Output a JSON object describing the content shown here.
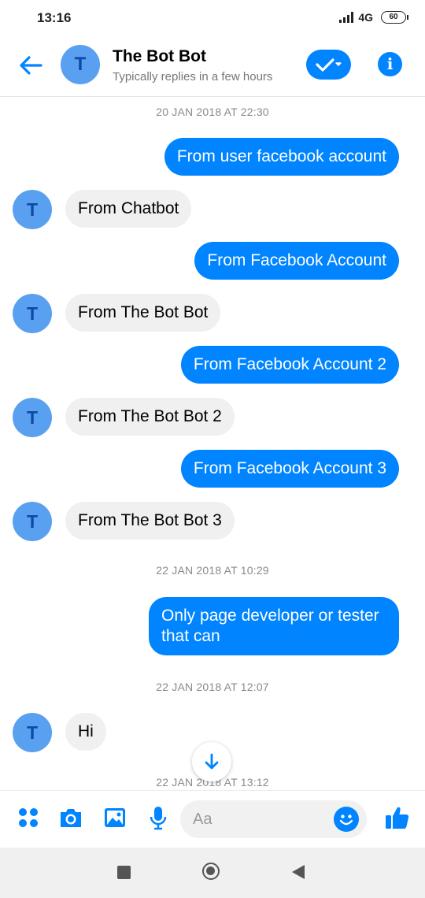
{
  "status_bar": {
    "time": "13:16",
    "network": "4G",
    "battery": "60"
  },
  "header": {
    "title": "The Bot Bot",
    "subtitle": "Typically replies in a few hours",
    "avatar_letter": "T",
    "accent_color": "#0084ff"
  },
  "messages": {
    "timestamp_1": "20 JAN 2018 AT 22:30",
    "out_1": "From user facebook account",
    "in_1": "From Chatbot",
    "out_2": "From Facebook Account",
    "in_2": "From The Bot Bot",
    "out_3": "From Facebook Account 2",
    "in_3": "From The Bot Bot 2",
    "out_4": "From Facebook Account 3",
    "in_4": "From The Bot Bot 3",
    "timestamp_2": "22 JAN 2018 AT 10:29",
    "out_5": "Only page developer or tester that can",
    "timestamp_3": "22 JAN 2018 AT 12:07",
    "in_5": "Hi",
    "timestamp_4": "22 JAN 2018 AT 13:12"
  },
  "composer": {
    "placeholder": "Aa"
  },
  "icons": [
    "back-arrow-icon",
    "check-icon",
    "info-icon",
    "apps-icon",
    "camera-icon",
    "gallery-icon",
    "microphone-icon",
    "emoji-icon",
    "thumbs-up-icon",
    "scroll-down-arrow-icon"
  ]
}
